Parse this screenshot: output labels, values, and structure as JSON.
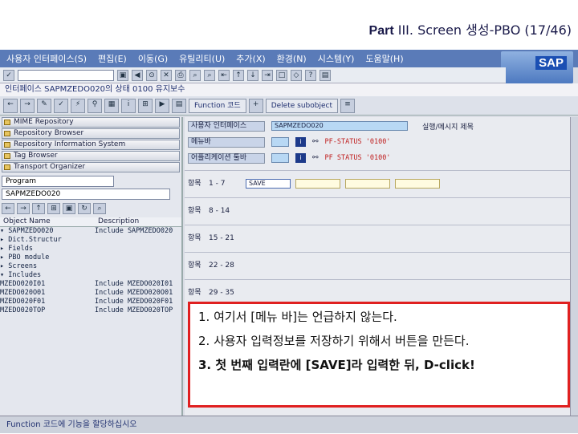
{
  "slide": {
    "title_part": "Part",
    "title_rest": "III. Screen 생성-PBO (17/46)"
  },
  "menubar": [
    "사용자 인터페이스(S)",
    "편집(E)",
    "이동(G)",
    "유틸리티(U)",
    "추가(X)",
    "환경(N)",
    "시스템(Y)",
    "도움말(H)"
  ],
  "sap": {
    "logo_text": "SAP"
  },
  "titlebar": {
    "text": "인터페이스 SAPMZEDO020의 상태 0100 유지보수"
  },
  "app_toolbar": {
    "function_code": "Function 코드",
    "delete_subobject": "Delete subobject"
  },
  "nav_buttons": [
    "MIME Repository",
    "Repository Browser",
    "Repository Information System",
    "Tag Browser",
    "Transport Organizer"
  ],
  "object_type": {
    "value": "Program"
  },
  "object_name": {
    "value": "SAPMZEDO020"
  },
  "tree_header": {
    "name": "Object Name",
    "description": "Description"
  },
  "tree": [
    {
      "name": "▾ SAPMZEDO020",
      "desc": "Include SAPMZEDO020"
    },
    {
      "name": "  ▸ Dict.Structur",
      "desc": ""
    },
    {
      "name": "  ▸ Fields",
      "desc": ""
    },
    {
      "name": "  ▸ PBO module",
      "desc": ""
    },
    {
      "name": "  ▸ Screens",
      "desc": ""
    },
    {
      "name": "  ▾ Includes",
      "desc": ""
    },
    {
      "name": "    MZEDO020I01",
      "desc": "Include MZEDO020I01"
    },
    {
      "name": "    MZEDO020O01",
      "desc": "Include MZEDO020O01"
    },
    {
      "name": "    MZEDO020F01",
      "desc": "Include MZEDO020F01"
    },
    {
      "name": "    MZEDO020TOP",
      "desc": "Include MZEDO020TOP"
    }
  ],
  "form": {
    "ui_label": "사용자 인터페이스",
    "ui_value": "SAPMZEDO020",
    "ui_status": "실행/메시지 제목",
    "menu_label": "메뉴바",
    "menu_status": "PF-STATUS '0100'",
    "apptb_label": "어플리케이션 툴바",
    "apptb_status": "PF STATUS '0100'"
  },
  "keys": [
    {
      "label": "항목",
      "range": "1 - 7",
      "first": "SAVE"
    },
    {
      "label": "항목",
      "range": "8 - 14",
      "first": ""
    },
    {
      "label": "항목",
      "range": "15 - 21",
      "first": ""
    },
    {
      "label": "항목",
      "range": "22 - 28",
      "first": ""
    },
    {
      "label": "항목",
      "range": "29 - 35",
      "first": ""
    }
  ],
  "callout": {
    "line1": "1. 여기서 [메뉴 바]는 언급하지 않는다.",
    "line2": "2. 사용자 입력정보를 저장하기 위해서 버튼을 만든다.",
    "line3": "3. 첫 번째 입력란에 [SAVE]라 입력한 뒤, D-click!"
  },
  "status_bar": {
    "text": "Function 코드에 기능을 할당하십시오"
  }
}
